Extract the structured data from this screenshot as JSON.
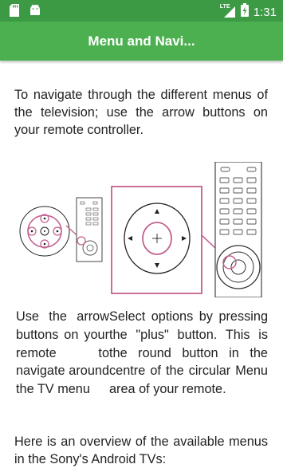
{
  "status_bar": {
    "time": "1:31",
    "network_label": "LTE",
    "icons": [
      "sd-card-icon",
      "android-icon",
      "signal-icon",
      "battery-charging-icon"
    ]
  },
  "app_bar": {
    "title": "Menu and Navi..."
  },
  "intro_text": "To navigate through the different menus of the television; use the arrow buttons on your remote controller.",
  "figure": {
    "accent_color": "#c2608f"
  },
  "columns": {
    "left": "Use the arrow buttons on your remote to navigate around the TV menu",
    "right": "Select options by pressing the \"plus\" button. This is the round button in the centre of the circular Menu area of your remote."
  },
  "overview_text": "Here is an overview of the available menus in the Sony's Android TVs:",
  "colors": {
    "status_bar": "#3d9a44",
    "app_bar": "#4caf50"
  }
}
